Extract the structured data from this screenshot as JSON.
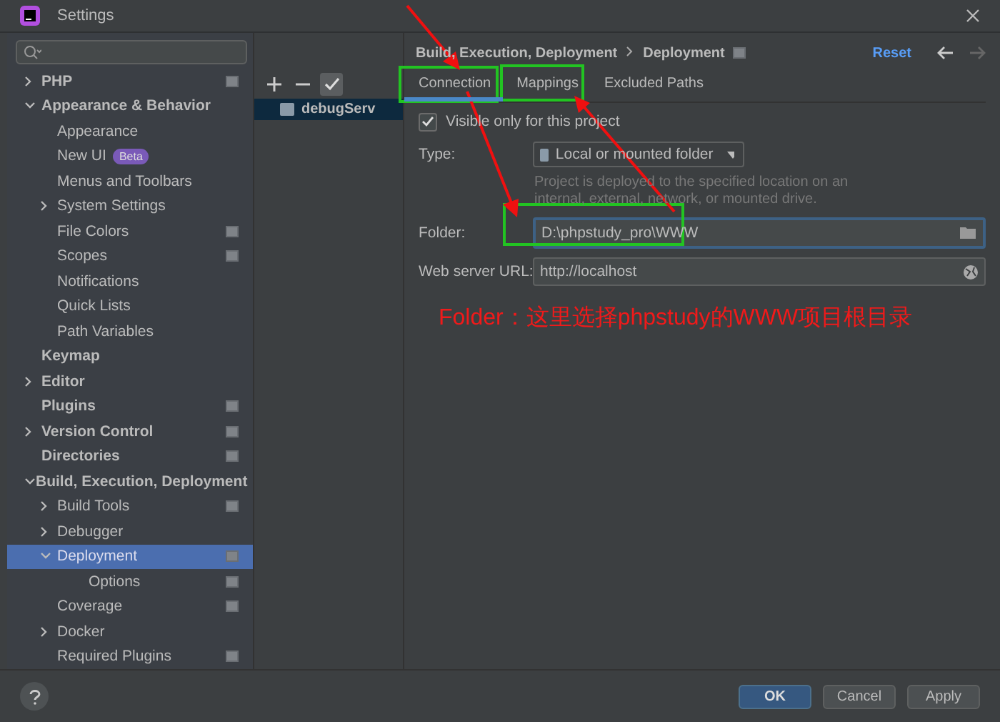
{
  "window": {
    "title": "Settings"
  },
  "search": {
    "kind": "search"
  },
  "sidebar": {
    "items": [
      {
        "label": "PHP",
        "expanded": false,
        "project_level": true
      },
      {
        "label": "Appearance & Behavior",
        "expanded": true,
        "children": [
          {
            "label": "Appearance"
          },
          {
            "label": "New UI",
            "badge": "Beta"
          },
          {
            "label": "Menus and Toolbars"
          },
          {
            "label": "System Settings",
            "expanded": false
          },
          {
            "label": "File Colors",
            "project_level": true
          },
          {
            "label": "Scopes",
            "project_level": true
          },
          {
            "label": "Notifications"
          },
          {
            "label": "Quick Lists"
          },
          {
            "label": "Path Variables"
          }
        ]
      },
      {
        "label": "Keymap"
      },
      {
        "label": "Editor",
        "expanded": false
      },
      {
        "label": "Plugins",
        "project_level": true
      },
      {
        "label": "Version Control",
        "expanded": false,
        "project_level": true
      },
      {
        "label": "Directories",
        "project_level": true
      },
      {
        "label": "Build, Execution, Deployment",
        "expanded": true,
        "children": [
          {
            "label": "Build Tools",
            "expanded": false,
            "project_level": true
          },
          {
            "label": "Debugger",
            "expanded": false
          },
          {
            "label": "Deployment",
            "expanded": true,
            "selected": true,
            "project_level": true,
            "children": [
              {
                "label": "Options",
                "project_level": true
              }
            ]
          },
          {
            "label": "Coverage",
            "project_level": true
          },
          {
            "label": "Docker",
            "expanded": false
          },
          {
            "label": "Required Plugins",
            "project_level": true
          }
        ]
      }
    ]
  },
  "breadcrumb": [
    "Build, Execution, Deployment",
    "Deployment"
  ],
  "reset": "Reset",
  "servers": [
    {
      "name": "debugServ",
      "selected": true
    }
  ],
  "tabs": [
    {
      "label": "Connection",
      "selected": true
    },
    {
      "label": "Mappings",
      "selected": false
    },
    {
      "label": "Excluded Paths",
      "selected": false
    }
  ],
  "visible_only": {
    "label": "Visible only for this project",
    "checked": true
  },
  "type": {
    "label": "Type:",
    "value": "Local or mounted folder",
    "hint": "Project is deployed to the specified location on an internal, external, network, or mounted drive."
  },
  "folder": {
    "label": "Folder:",
    "value": "D:\\phpstudy_pro\\WWW"
  },
  "web_server_url": {
    "label": "Web server URL:",
    "value": "http://localhost"
  },
  "annotation": {
    "note": "Folder：这里选择phpstudy的WWW项目根目录"
  },
  "buttons": [
    {
      "label": "OK",
      "kind": "primary"
    },
    {
      "label": "Cancel",
      "kind": "normal"
    },
    {
      "label": "Apply",
      "kind": "normal"
    }
  ]
}
